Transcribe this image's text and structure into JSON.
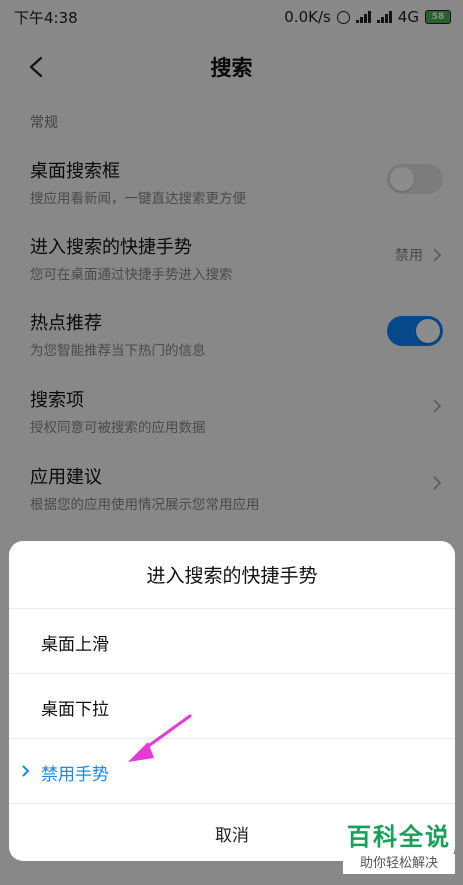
{
  "status": {
    "time": "下午4:38",
    "network_speed": "0.0K/s",
    "network_type": "4G",
    "battery": "58"
  },
  "header": {
    "title": "搜索"
  },
  "section_label": "常规",
  "settings": [
    {
      "title": "桌面搜索框",
      "subtitle": "搜应用看新闻，一键直达搜索更方便"
    },
    {
      "title": "进入搜索的快捷手势",
      "subtitle": "您可在桌面通过快捷手势进入搜索",
      "value": "禁用"
    },
    {
      "title": "热点推荐",
      "subtitle": "为您智能推荐当下热门的信息"
    },
    {
      "title": "搜索项",
      "subtitle": "授权同意可被搜索的应用数据"
    },
    {
      "title": "应用建议",
      "subtitle": "根据您的应用使用情况展示您常用应用"
    }
  ],
  "dialog": {
    "title": "进入搜索的快捷手势",
    "options": [
      {
        "label": "桌面上滑"
      },
      {
        "label": "桌面下拉"
      },
      {
        "label": "禁用手势"
      }
    ],
    "cancel": "取消"
  },
  "watermark": {
    "main": "百科全说",
    "sub": "助你轻松解决"
  },
  "colors": {
    "accent": "#1789f7",
    "toggle_on": "#0d84ff",
    "annotation_arrow": "#e53ad9",
    "watermark": "#18a05a"
  },
  "toggle_states": {
    "desktop_search_box": false,
    "hot_recommend": true
  }
}
